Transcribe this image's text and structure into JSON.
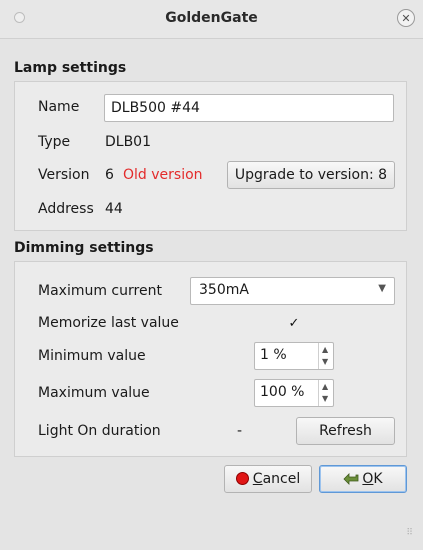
{
  "window": {
    "title": "GoldenGate"
  },
  "lamp": {
    "section_title": "Lamp settings",
    "name_label": "Name",
    "name_value": "DLB500 #44",
    "type_label": "Type",
    "type_value": "DLB01",
    "version_label": "Version",
    "version_value": "6",
    "version_status": "Old version",
    "upgrade_button": "Upgrade to version: 8",
    "address_label": "Address",
    "address_value": "44"
  },
  "dimming": {
    "section_title": "Dimming settings",
    "max_current_label": "Maximum current",
    "max_current_value": "350mA",
    "memorize_label": "Memorize last value",
    "memorize_checked": true,
    "min_label": "Minimum value",
    "min_value": "1 %",
    "max_label": "Maximum value",
    "max_value": "100 %",
    "light_on_label": "Light On duration",
    "light_on_value": "-",
    "refresh_button": "Refresh"
  },
  "buttons": {
    "cancel_accel": "C",
    "cancel_rest": "ancel",
    "ok_accel": "O",
    "ok_rest": "K"
  },
  "colors": {
    "warning": "#e32b2b",
    "accent": "#5f98d6"
  }
}
